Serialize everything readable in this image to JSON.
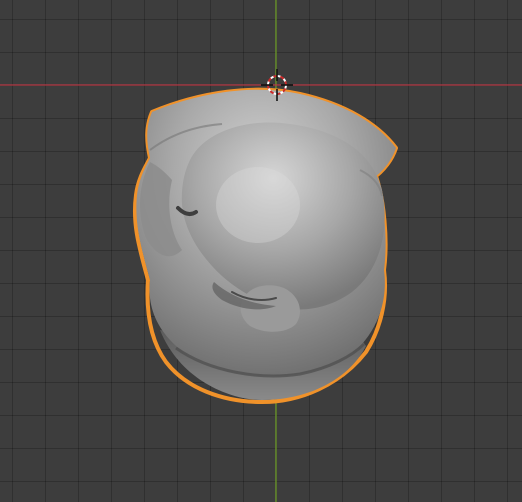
{
  "viewport": {
    "background_color": "#3d3d3d",
    "grid_line_color": "#333333",
    "x_axis_color": "#b53a45",
    "y_axis_color": "#6e9b2a",
    "selection_outline_color": "#f0922a",
    "object_shading": "solid-gray",
    "object_selected": true,
    "cursor_icon": "3d-cursor-icon"
  }
}
